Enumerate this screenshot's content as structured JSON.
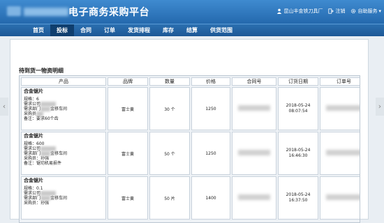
{
  "header": {
    "title": "电子商务采购平台",
    "user": "昆山丰金铁刀具厂",
    "logout": "注销",
    "service": "自助服务"
  },
  "nav": [
    "首页",
    "投标",
    "合同",
    "订单",
    "发货排程",
    "库存",
    "结算",
    "供货范围"
  ],
  "active_nav": "投标",
  "section_title": "待到货一物资明细",
  "table": {
    "columns": [
      "产品",
      "品牌",
      "数量",
      "价格",
      "合同号",
      "订货日期",
      "订单号"
    ],
    "rows": [
      {
        "name": "合金锯片",
        "spec": "规格：6",
        "dept": "需求公司",
        "dept2": "需求部门",
        "dept2_tail": "金移车间",
        "buyer": "采购员",
        "note": "备注：要求60个齿",
        "brand": "富士黄",
        "qty": "30 个",
        "price": "1250",
        "date": "2018-05-24",
        "time": "08:07:54"
      },
      {
        "name": "合金锯片",
        "spec": "规格：600",
        "dept": "需求公司",
        "dept2": "需求部门",
        "dept2_tail": "金移车间",
        "buyer": "采购员：孙强",
        "note": "备注：锯切机易损件",
        "brand": "富士黄",
        "qty": "50 个",
        "price": "1250",
        "date": "2018-05-24",
        "time": "16:46:30"
      },
      {
        "name": "合金锯片",
        "spec": "规格：0.1",
        "dept": "需求公司",
        "dept2": "需求部门",
        "dept2_tail": "金移车间",
        "buyer": "采购员：孙强",
        "note": "",
        "brand": "富士黄",
        "qty": "50 片",
        "price": "1400",
        "date": "2018-05-24",
        "time": "16:37:50"
      }
    ]
  }
}
